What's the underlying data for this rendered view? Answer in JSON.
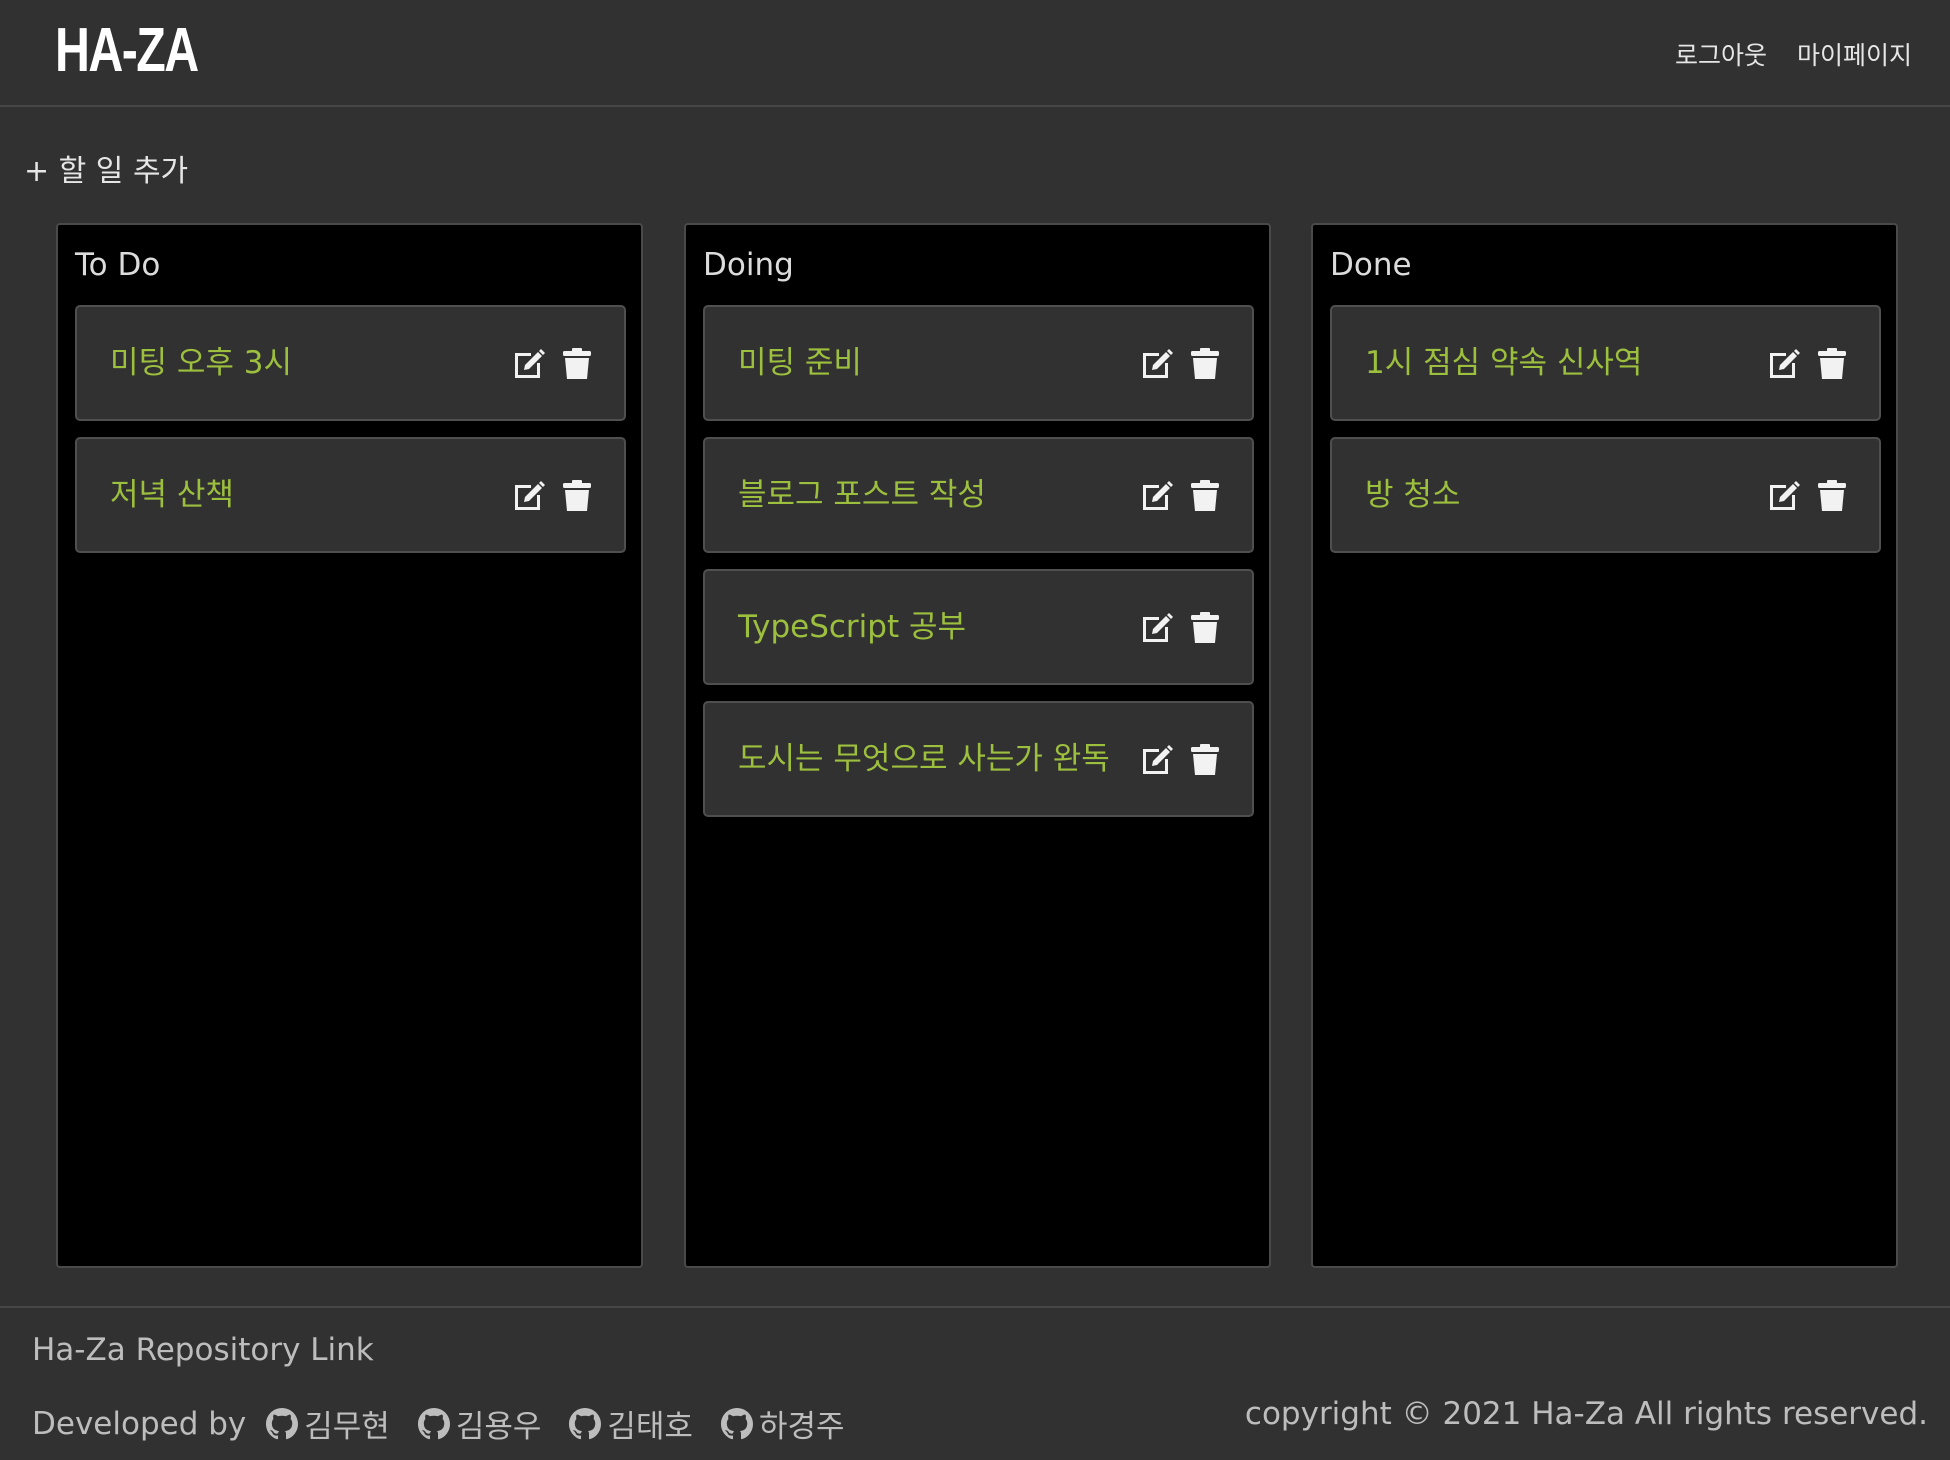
{
  "header": {
    "logo": "HA-ZA",
    "nav": {
      "logout": "로그아웃",
      "mypage": "마이페이지"
    }
  },
  "add_task_label": "+ 할 일 추가",
  "columns": [
    {
      "title": "To Do",
      "cards": [
        "미팅 오후 3시",
        "저녁 산책"
      ]
    },
    {
      "title": "Doing",
      "cards": [
        "미팅 준비",
        "블로그 포스트 작성",
        "TypeScript 공부",
        "도시는 무엇으로 사는가 완독"
      ]
    },
    {
      "title": "Done",
      "cards": [
        "1시 점심 약속 신사역",
        "방 청소"
      ]
    }
  ],
  "footer": {
    "repo_link": "Ha-Za Repository Link",
    "developed_by": "Developed by",
    "developers": [
      "김무현",
      "김용우",
      "김태호",
      "하경주"
    ],
    "copyright": "copyright © 2021 Ha-Za All rights reserved."
  },
  "colors": {
    "background": "#313131",
    "column_bg": "#000000",
    "card_bg": "#313131",
    "card_text": "#9dbf3e"
  },
  "icons": {
    "edit": "edit-icon",
    "delete": "trash-icon",
    "developer": "github-icon"
  }
}
